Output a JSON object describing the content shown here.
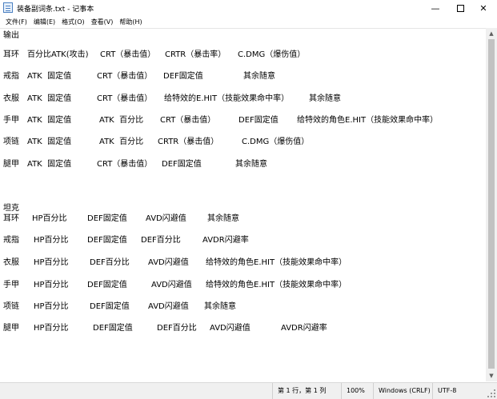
{
  "window": {
    "title": "装备副词条.txt - 记事本",
    "minimize_glyph": "—",
    "close_glyph": "✕",
    "icon": "notepad-icon"
  },
  "menu": [
    "文件(F)",
    "编辑(E)",
    "格式(O)",
    "查看(V)",
    "帮助(H)"
  ],
  "document": {
    "lines": [
      [
        "输出"
      ],
      [],
      [
        "耳环",
        "百分比ATK(攻击)",
        "CRT（暴击值）",
        "CRTR（暴击率）",
        "C.DMG（爆伤值）"
      ],
      [],
      [
        "戒指",
        "ATK  固定值",
        "CRT（暴击值）",
        "DEF固定值",
        "其余随意"
      ],
      [],
      [
        "衣服",
        "ATK  固定值",
        "CRT（暴击值）",
        "给特效的E.HIT（技能效果命中率）",
        "其余随意"
      ],
      [],
      [
        "手甲",
        "ATK  固定值",
        "ATK  百分比",
        "CRT（暴击值）",
        "DEF固定值",
        "给特效的角色E.HIT（技能效果命中率）"
      ],
      [],
      [
        "项链",
        "ATK  固定值",
        "ATK  百分比",
        "CRTR（暴击值）",
        "C.DMG（爆伤值）"
      ],
      [],
      [
        "腿甲",
        "ATK  固定值",
        "CRT（暴击值）",
        "DEF固定值",
        "其余随意"
      ],
      [],
      [],
      [],
      [],
      [
        "坦克"
      ],
      [
        "耳环",
        "HP百分比",
        "DEF固定值",
        "AVD闪避值",
        "其余随意"
      ],
      [],
      [
        "戒指",
        "HP百分比",
        "DEF固定值",
        "DEF百分比",
        "AVDR闪避率"
      ],
      [],
      [
        "衣服",
        "HP百分比",
        "DEF百分比",
        "AVD闪避值",
        "给特效的角色E.HIT（技能效果命中率）"
      ],
      [],
      [
        "手甲",
        "HP百分比",
        "DEF固定值",
        "AVD闪避值",
        "给特效的角色E.HIT（技能效果命中率）"
      ],
      [],
      [
        "项链",
        "HP百分比",
        "DEF固定值",
        "AVD闪避值",
        "其余随意"
      ],
      [],
      [
        "腿甲",
        "HP百分比",
        "DEF固定值",
        "DEF百分比",
        "AVD闪避值",
        "AVDR闪避率"
      ]
    ]
  },
  "status": {
    "position": "第 1 行，第 1 列",
    "zoom": "100%",
    "line_ending": "Windows (CRLF)",
    "encoding": "UTF-8"
  }
}
